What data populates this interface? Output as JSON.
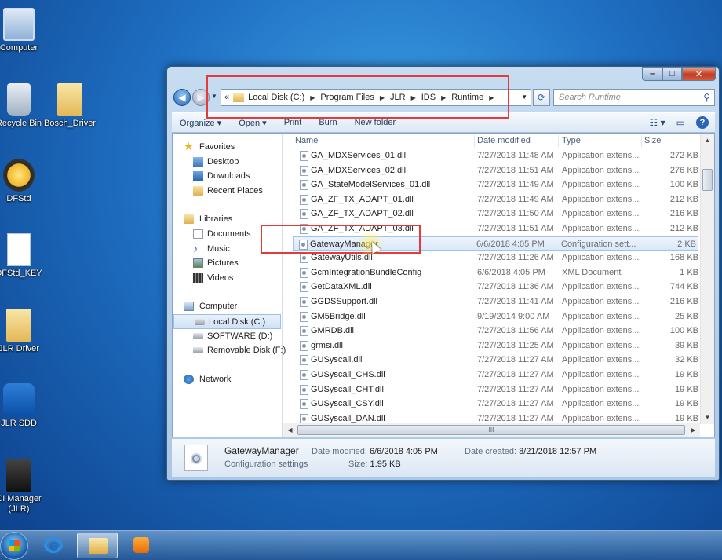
{
  "desktop": {
    "icons": [
      {
        "label": "Computer"
      },
      {
        "label": "Recycle Bin"
      },
      {
        "label": "Bosch_Driver"
      },
      {
        "label": "DFStd"
      },
      {
        "label": "DFStd_KEY"
      },
      {
        "label": "JLR Driver"
      },
      {
        "label": "JLR SDD"
      },
      {
        "label": "CI Manager (JLR)"
      }
    ]
  },
  "window": {
    "caption": {
      "min": "–",
      "max": "□",
      "close": "✕"
    },
    "address": {
      "crumbs": [
        "Local Disk (C:)",
        "Program Files",
        "JLR",
        "IDS",
        "Runtime"
      ],
      "lead": "«"
    },
    "search_placeholder": "Search Runtime",
    "toolbar": {
      "organize": "Organize ▾",
      "open": "Open ▾",
      "print": "Print",
      "burn": "Burn",
      "new_folder": "New folder"
    },
    "navpane": {
      "favorites": "Favorites",
      "desktop": "Desktop",
      "downloads": "Downloads",
      "recent": "Recent Places",
      "libraries": "Libraries",
      "documents": "Documents",
      "music": "Music",
      "pictures": "Pictures",
      "videos": "Videos",
      "computer": "Computer",
      "local_disk": "Local Disk (C:)",
      "software": "SOFTWARE (D:)",
      "removable": "Removable Disk (F:)",
      "network": "Network"
    },
    "columns": {
      "name": "Name",
      "date": "Date modified",
      "type": "Type",
      "size": "Size"
    },
    "files": [
      {
        "name": "GA_MDXServices_01.dll",
        "date": "7/27/2018 11:48 AM",
        "type": "Application extens...",
        "size": "272 KB"
      },
      {
        "name": "GA_MDXServices_02.dll",
        "date": "7/27/2018 11:51 AM",
        "type": "Application extens...",
        "size": "276 KB"
      },
      {
        "name": "GA_StateModelServices_01.dll",
        "date": "7/27/2018 11:49 AM",
        "type": "Application extens...",
        "size": "100 KB"
      },
      {
        "name": "GA_ZF_TX_ADAPT_01.dll",
        "date": "7/27/2018 11:49 AM",
        "type": "Application extens...",
        "size": "212 KB"
      },
      {
        "name": "GA_ZF_TX_ADAPT_02.dll",
        "date": "7/27/2018 11:50 AM",
        "type": "Application extens...",
        "size": "216 KB"
      },
      {
        "name": "GA_ZF_TX_ADAPT_03.dll",
        "date": "7/27/2018 11:51 AM",
        "type": "Application extens...",
        "size": "212 KB"
      },
      {
        "name": "GatewayManager",
        "date": "6/6/2018 4:05 PM",
        "type": "Configuration sett...",
        "size": "2 KB"
      },
      {
        "name": "GatewayUtils.dll",
        "date": "7/27/2018 11:26 AM",
        "type": "Application extens...",
        "size": "168 KB"
      },
      {
        "name": "GcmIntegrationBundleConfig",
        "date": "6/6/2018 4:05 PM",
        "type": "XML Document",
        "size": "1 KB"
      },
      {
        "name": "GetDataXML.dll",
        "date": "7/27/2018 11:36 AM",
        "type": "Application extens...",
        "size": "744 KB"
      },
      {
        "name": "GGDSSupport.dll",
        "date": "7/27/2018 11:41 AM",
        "type": "Application extens...",
        "size": "216 KB"
      },
      {
        "name": "GM5Bridge.dll",
        "date": "9/19/2014 9:00 AM",
        "type": "Application extens...",
        "size": "25 KB"
      },
      {
        "name": "GMRDB.dll",
        "date": "7/27/2018 11:56 AM",
        "type": "Application extens...",
        "size": "100 KB"
      },
      {
        "name": "grmsi.dll",
        "date": "7/27/2018 11:25 AM",
        "type": "Application extens...",
        "size": "39 KB"
      },
      {
        "name": "GUSyscall.dll",
        "date": "7/27/2018 11:27 AM",
        "type": "Application extens...",
        "size": "32 KB"
      },
      {
        "name": "GUSyscall_CHS.dll",
        "date": "7/27/2018 11:27 AM",
        "type": "Application extens...",
        "size": "19 KB"
      },
      {
        "name": "GUSyscall_CHT.dll",
        "date": "7/27/2018 11:27 AM",
        "type": "Application extens...",
        "size": "19 KB"
      },
      {
        "name": "GUSyscall_CSY.dll",
        "date": "7/27/2018 11:27 AM",
        "type": "Application extens...",
        "size": "19 KB"
      },
      {
        "name": "GUSyscall_DAN.dll",
        "date": "7/27/2018 11:27 AM",
        "type": "Application extens...",
        "size": "19 KB"
      }
    ],
    "hscroll_grip": "III",
    "details": {
      "name": "GatewayManager",
      "type": "Configuration settings",
      "modified_label": "Date modified:",
      "modified_value": "6/6/2018 4:05 PM",
      "size_label": "Size:",
      "size_value": "1.95 KB",
      "created_label": "Date created:",
      "created_value": "8/21/2018 12:57 PM"
    }
  },
  "colors": {
    "highlight_box": "#e43a3a",
    "selection": "#d9e8f9"
  }
}
